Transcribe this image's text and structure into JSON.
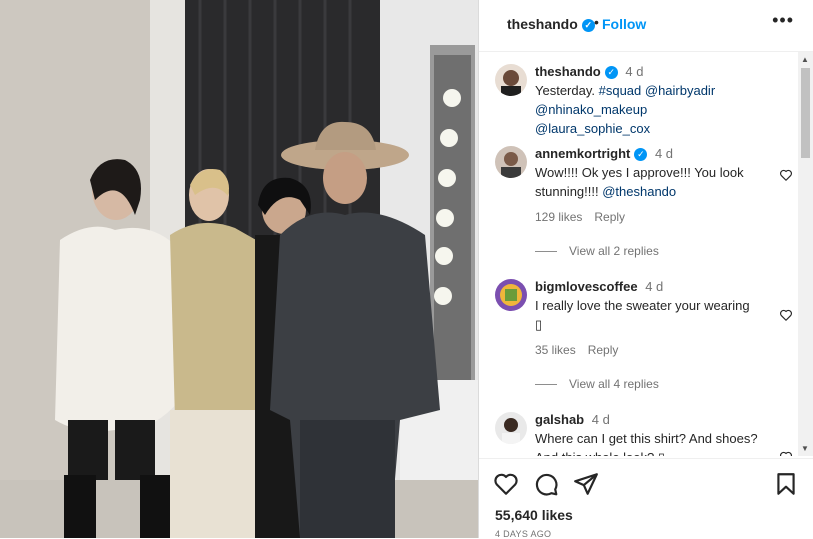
{
  "post": {
    "username": "theshando",
    "follow_label": "Follow",
    "separator": "•",
    "more_label": "•••",
    "caption_user": "theshando",
    "caption_time": "4 d",
    "caption_text_start": "Yesterday. ",
    "caption_mentions": "#squad @hairbyadir @nhinako_makeup @laura_sophie_cox",
    "likes": "55,640 likes",
    "date": "4 DAYS AGO"
  },
  "comments": [
    {
      "user": "annemkortright",
      "verified": true,
      "time": "4 d",
      "text_start": "Wow!!!! Ok yes I approve!!! You look stunning!!!! ",
      "mention": "@theshando",
      "likes": "129 likes",
      "reply": "Reply",
      "replies": "View all 2 replies"
    },
    {
      "user": "bigmlovescoffee",
      "verified": false,
      "time": "4 d",
      "text": "I really love the sweater your wearing ▯",
      "likes": "35 likes",
      "reply": "Reply",
      "replies": "View all 4 replies"
    },
    {
      "user": "galshab",
      "verified": false,
      "time": "4 d",
      "text": "Where can I get this shirt? And shoes? And this whole look? ▯"
    }
  ],
  "icons": {
    "verified": "verified-badge-icon",
    "like": "heart-icon",
    "comment": "comment-icon",
    "share": "share-icon",
    "save": "bookmark-icon"
  },
  "colors": {
    "accent": "#0095f6",
    "text": "#262626",
    "muted": "#737373",
    "mention": "#00376b"
  }
}
